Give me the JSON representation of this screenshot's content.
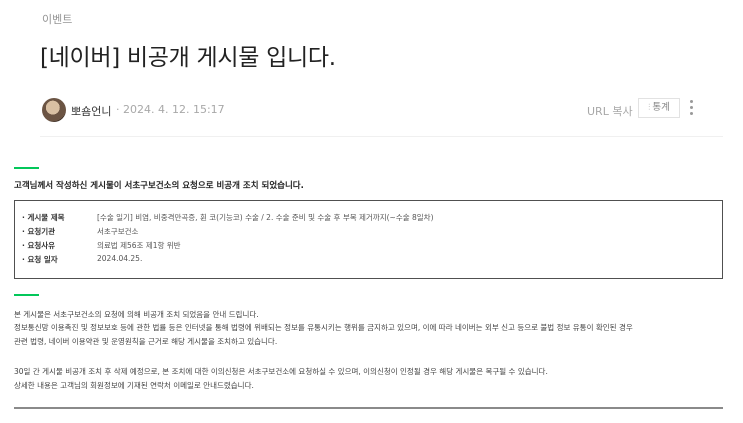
{
  "post": {
    "category": "이벤트",
    "title": "[네이버] 비공개 게시물 입니다.",
    "author": "뽀숌언니",
    "date": "· 2024. 4. 12. 15:17",
    "url_copy": "URL 복사",
    "stats_label": "통계",
    "stats_icon": "bar-chart-icon",
    "more_icon": "more-vertical-icon"
  },
  "notice": {
    "heading": "고객님께서 작성하신 게시물이 서초구보건소의 요청으로 비공개 조치 되었습니다.",
    "details": [
      {
        "label": "게시물 제목",
        "value": "[수술 일기] 비염, 비중격만곡증, 휜 코(기능코) 수술 / 2. 수술 준비 및 수술 후 부목 제거까지(~수술 8일차)"
      },
      {
        "label": "요청기관",
        "value": "서초구보건소"
      },
      {
        "label": "요청사유",
        "value": "의료법 제56조 제1항 위반"
      },
      {
        "label": "요청 일자",
        "value": "2024.04.25."
      }
    ],
    "paragraphs": [
      "본 게시물은 서초구보건소의 요청에 의해 비공개 조치 되었음을 안내 드립니다.",
      "정보통신망 이용촉진 및 정보보호 등에 관한 법률 등은 인터넷을 통해 법령에 위배되는 정보를 유통시키는 행위를 금지하고 있으며, 이에 따라 네이버는 외부 신고 등으로 불법 정보 유통이 확인된 경우",
      "관련 법령, 네이버 이용약관 및 운영원칙을 근거로 해당 게시물을 조치하고 있습니다.",
      "30일 간 게시물 비공개 조치 후 삭제 예정으로, 본 조치에 대한 이의신청은 서초구보건소에 요청하실 수 있으며, 이의신청이 인정될 경우 해당 게시물은 복구될 수 있습니다.",
      "상세한 내용은 고객님의 회원정보에 기재된 연락처 이메일로 안내드렸습니다."
    ]
  },
  "colors": {
    "accent_green": "#03c75a",
    "title_text": "#222222",
    "meta_gray": "#a8a8a8"
  }
}
